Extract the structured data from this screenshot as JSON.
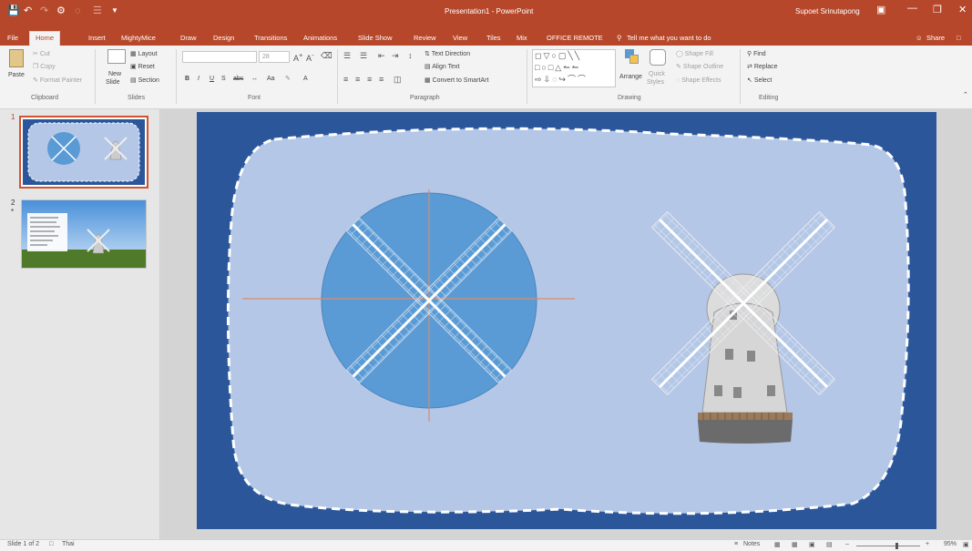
{
  "window": {
    "title": "Presentation1 - PowerPoint",
    "user": "Supoet Srinutapong"
  },
  "tabs": [
    "File",
    "Home",
    "Insert",
    "MightyMice",
    "Draw",
    "Design",
    "Transitions",
    "Animations",
    "Slide Show",
    "Review",
    "View",
    "Tiles",
    "Mix",
    "OFFICE REMOTE"
  ],
  "tell_me": "Tell me what you want to do",
  "share": "Share",
  "ribbon": {
    "clipboard": {
      "label": "Clipboard",
      "paste": "Paste",
      "cut": "Cut",
      "copy": "Copy",
      "format_painter": "Format Painter"
    },
    "slides": {
      "label": "Slides",
      "new_slide_1": "New",
      "new_slide_2": "Slide",
      "layout": "Layout",
      "reset": "Reset",
      "section": "Section"
    },
    "font": {
      "label": "Font",
      "size": "28",
      "case": "Aa"
    },
    "paragraph": {
      "label": "Paragraph",
      "text_direction": "Text Direction",
      "align_text": "Align Text",
      "convert": "Convert to SmartArt"
    },
    "drawing": {
      "label": "Drawing",
      "arrange": "Arrange",
      "quick_styles_1": "Quick",
      "quick_styles_2": "Styles",
      "shape_fill": "Shape Fill",
      "shape_outline": "Shape Outline",
      "shape_effects": "Shape Effects"
    },
    "editing": {
      "label": "Editing",
      "find": "Find",
      "replace": "Replace",
      "select": "Select"
    }
  },
  "thumbnails": [
    {
      "number": "1",
      "star": ""
    },
    {
      "number": "2",
      "star": "*"
    }
  ],
  "status": {
    "slide_info": "Slide 1 of 2",
    "language": "Thai",
    "notes": "Notes",
    "zoom": "95%"
  },
  "colors": {
    "accent": "#b7472a",
    "slide_bg": "#2b579a",
    "panel": "#b4c7e7",
    "circle": "#5b9bd5"
  }
}
